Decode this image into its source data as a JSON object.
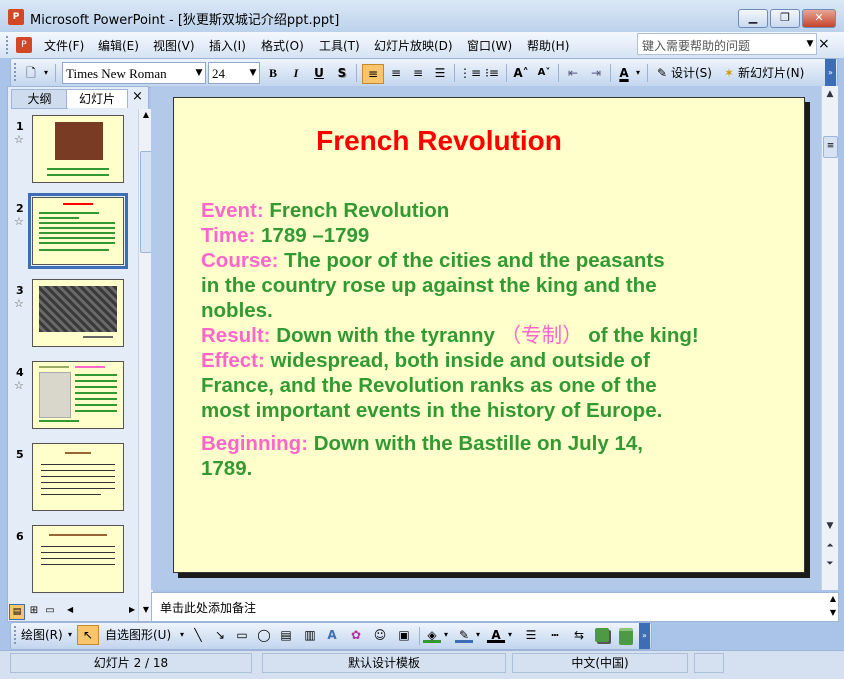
{
  "window": {
    "title": "Microsoft PowerPoint - [狄更斯双城记介绍ppt.ppt]",
    "app_icon": "powerpoint-icon"
  },
  "menu": [
    "文件(F)",
    "编辑(E)",
    "视图(V)",
    "插入(I)",
    "格式(O)",
    "工具(T)",
    "幻灯片放映(D)",
    "窗口(W)",
    "帮助(H)"
  ],
  "help_box": {
    "placeholder": "键入需要帮助的问题"
  },
  "toolbar": {
    "font_name": "Times New Roman",
    "font_size": "24",
    "bold": "B",
    "italic": "I",
    "underline": "U",
    "shadow": "S",
    "design_label": "设计(S)",
    "new_slide_label": "新幻灯片(N)"
  },
  "left_pane": {
    "tab_outline": "大纲",
    "tab_slides": "幻灯片",
    "close": "×",
    "thumbs": [
      {
        "num": "1",
        "star": "☆"
      },
      {
        "num": "2",
        "star": "☆"
      },
      {
        "num": "3",
        "star": "☆"
      },
      {
        "num": "4",
        "star": "☆"
      },
      {
        "num": "5",
        "star": ""
      },
      {
        "num": "6",
        "star": ""
      }
    ]
  },
  "slide": {
    "title": "French Revolution",
    "event_label": "Event:",
    "event_text": "French Revolution",
    "time_label": "Time:",
    "time_text": "1789 –1799",
    "course_label": "Course:",
    "course_text_1": "The poor of the cities and the peasants",
    "course_text_2": "in the country rose up against the king and the",
    "course_text_3": "nobles.",
    "result_label": "Result:",
    "result_text_a": "Down with the tyranny",
    "result_text_zh": "（专制）",
    "result_text_b": "of the king!",
    "effect_label": "Effect:",
    "effect_text_1": "widespread, both inside and outside of",
    "effect_text_2": "France, and the Revolution ranks as one of the",
    "effect_text_3": "most important events in the history of Europe.",
    "beginning_label": "Beginning:",
    "beginning_text_1": "Down with the Bastille on July 14,",
    "beginning_text_2": "1789."
  },
  "notes": {
    "placeholder": "单击此处添加备注"
  },
  "drawbar": {
    "draw_label": "绘图(R)",
    "autoshape_label": "自选图形(U)"
  },
  "status": {
    "slide_info": "幻灯片 2 / 18",
    "template": "默认设计模板",
    "language": "中文(中国)"
  },
  "colors": {
    "slide_bg": "#ffffcc",
    "title": "#ff0000",
    "label": "#ff66cc",
    "body": "#339933"
  }
}
